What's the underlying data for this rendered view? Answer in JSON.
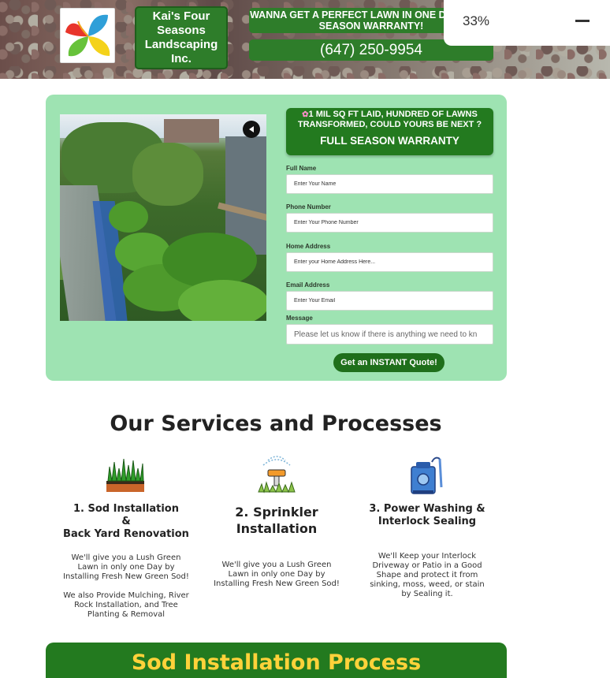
{
  "header": {
    "company_name": "Kai's Four Seasons Landscaping Inc.",
    "tagline": "WANNA GET A PERFECT LAWN IN ONE DAY? FULL SEASON WARRANTY!",
    "phone": "(647) 250-9954",
    "logo_icon": "pinwheel-leaf-logo",
    "colors": {
      "brand_green": "#2e7d2a",
      "accent": "#ffd23a"
    }
  },
  "progress": {
    "text": "33%",
    "collapse_icon": "minus-icon"
  },
  "form": {
    "heading_line1": "1 MIL SQ FT LAID, HUNDRED OF LAWNS TRANSFORMED, COULD YOURS BE NEXT ?",
    "heading_line2": "FULL SEASON WARRANTY",
    "heading_icon": "flower-icon",
    "fields": [
      {
        "label": "Full Name",
        "placeholder": "Enter Your Name"
      },
      {
        "label": "Phone Number",
        "placeholder": "Enter Your Phone Number"
      },
      {
        "label": "Home Address",
        "placeholder": "Enter your Home Address Here..."
      },
      {
        "label": "Email Address",
        "placeholder": "Enter Your Email"
      },
      {
        "label": "Message",
        "placeholder": "Please let us know if there is anything we need to kn"
      }
    ],
    "submit_label": "Get an INSTANT Quote!",
    "video_icon": "mute-icon"
  },
  "services": {
    "title": "Our Services and Processes",
    "items": [
      {
        "icon": "sod-grass-icon",
        "title": "1. Sod Installation\n&\nBack Yard Renovation",
        "description": "We'll give you a Lush Green Lawn in only one Day by Installing Fresh New Green Sod!\n\nWe also Provide Mulching, River Rock Installation, and Tree Planting & Removal"
      },
      {
        "icon": "sprinkler-icon",
        "title": "2. Sprinkler Installation",
        "description": "We'll give you a Lush Green Lawn in only one Day by Installing Fresh New Green Sod!"
      },
      {
        "icon": "pressure-washer-icon",
        "title": "3. Power Washing &\nInterlock Sealing",
        "description": "We'll Keep your Interlock Driveway or Patio in a Good Shape and protect it from sinking, moss, weed, or stain by Sealing it."
      }
    ]
  },
  "process": {
    "title": "Sod Installation Process"
  }
}
